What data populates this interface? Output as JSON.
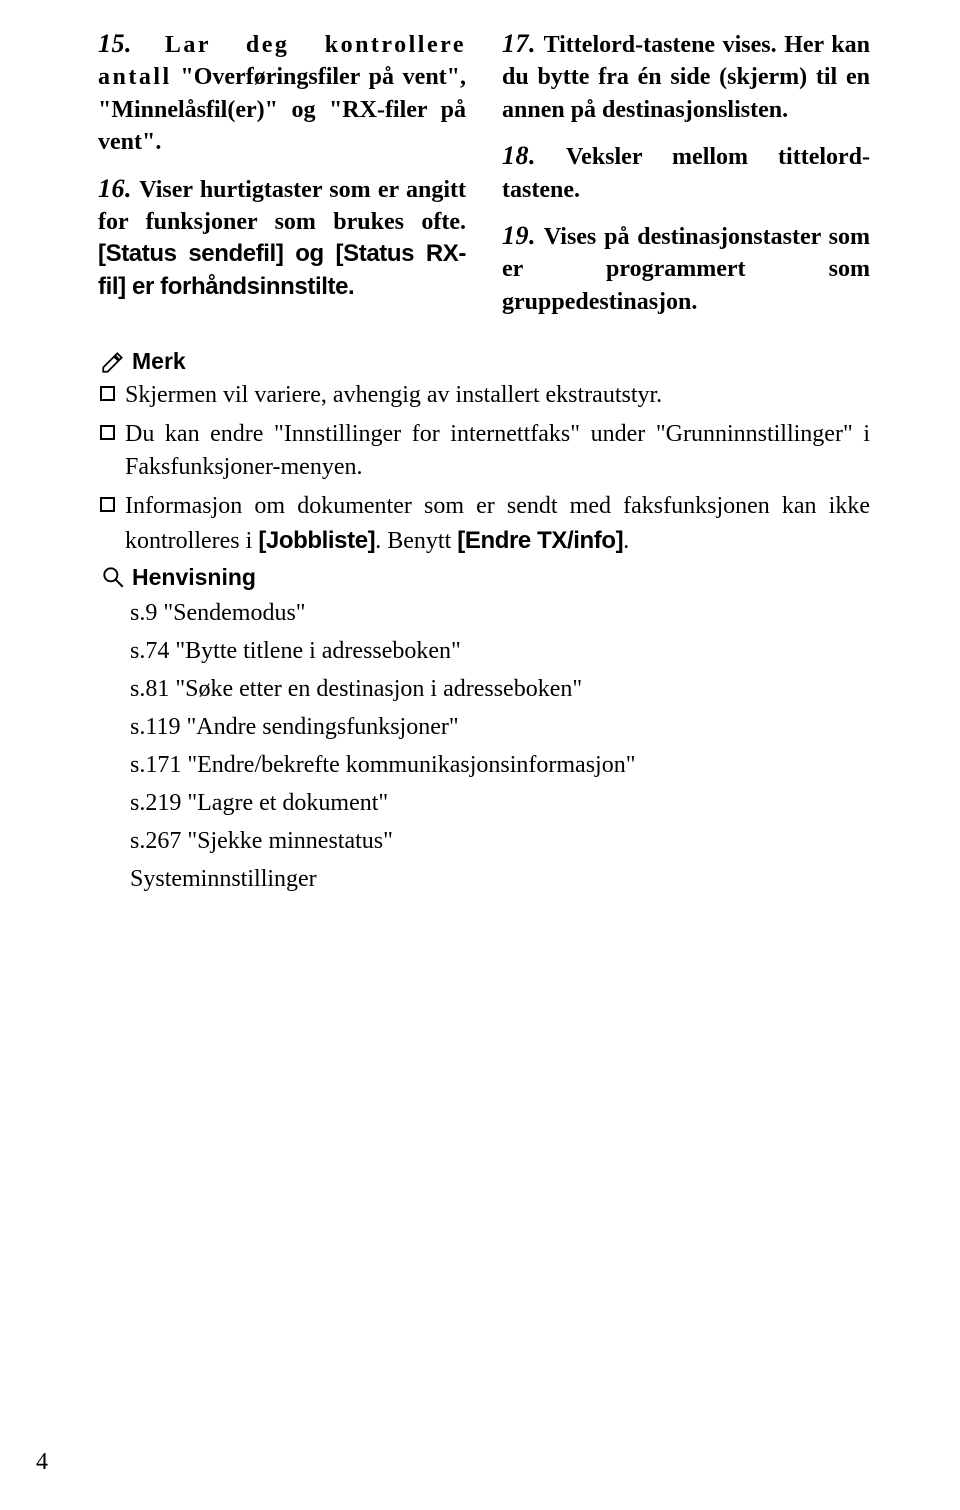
{
  "left_items": [
    {
      "num": "15.",
      "spaced": "Lar deg kontrollere antall",
      "rest": " \"Overføringsfiler på vent\", \"Minnelåsfil(er)\" og \"RX-filer på vent\"."
    },
    {
      "num": "16.",
      "bold": "Viser hurtigtaster som er angitt for funksjoner som brukes ofte.",
      "cond_parts": [
        "[Status sendefil]",
        " og ",
        "[Status RX-fil]",
        " er forhåndsinnstilte."
      ]
    }
  ],
  "right_items": [
    {
      "num": "17.",
      "bold": "Tittelord-tastene vises. Her kan du bytte fra én side (skjerm) til en annen på destinasjonslisten."
    },
    {
      "num": "18.",
      "bold": "Veksler mellom tittelord-tastene."
    },
    {
      "num": "19.",
      "bold": "Vises på destinasjonstaster som er programmert som gruppedestinasjon."
    }
  ],
  "merk_label": "Merk",
  "merk_bullets": [
    {
      "text": "Skjermen vil variere, avhengig av installert ekstrautstyr."
    },
    {
      "text": "Du kan endre \"Innstillinger for internettfaks\" under \"Grunninnstillinger\" i Faksfunksjoner-menyen."
    },
    {
      "pre": "Informasjon om dokumenter som er sendt med faksfunksjonen kan ikke kontrolleres i ",
      "c1": "[Jobbliste]",
      "mid": ". Benytt ",
      "c2": "[Endre TX/info]",
      "post": "."
    }
  ],
  "henvisning_label": "Henvisning",
  "refs": [
    "s.9 \"Sendemodus\"",
    "s.74 \"Bytte titlene i adresseboken\"",
    "s.81 \"Søke etter en destinasjon i adresseboken\"",
    "s.119 \"Andre sendingsfunksjoner\"",
    "s.171 \"Endre/bekrefte kommunikasjonsinformasjon\"",
    "s.219 \"Lagre et dokument\"",
    "s.267 \"Sjekke minnestatus\"",
    "Systeminnstillinger"
  ],
  "page_number": "4"
}
